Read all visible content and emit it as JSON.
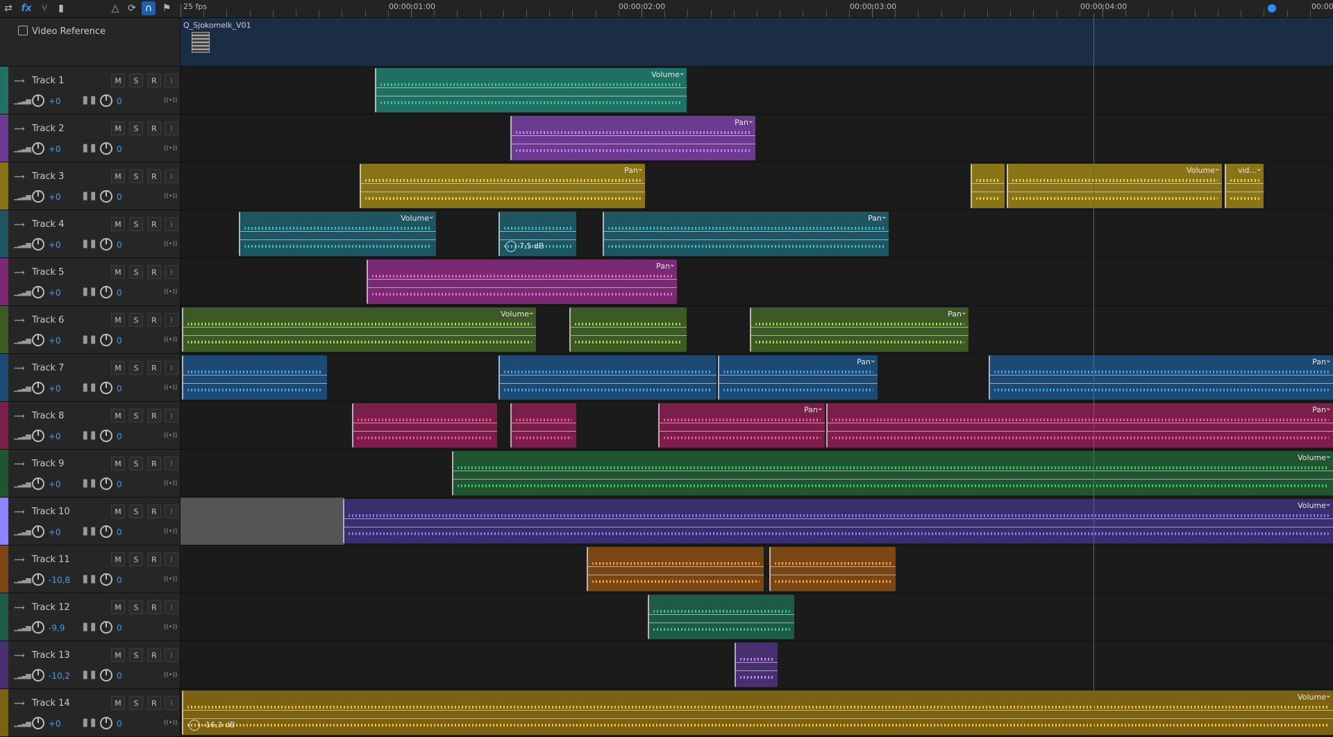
{
  "toolbar": {
    "icons": [
      "swap-arrows-icon",
      "fx-icon",
      "branch-icon",
      "bar-chart-icon",
      "metronome-icon",
      "loop-clip-icon",
      "headphones-icon",
      "marker-icon"
    ],
    "fx_label": "fx"
  },
  "ruler": {
    "fps": "25 fps",
    "timecodes": [
      "00:00:01:00",
      "00:00:02:00",
      "00:00:03:00",
      "00:00:04:00",
      "00:00"
    ]
  },
  "video_reference": {
    "label": "Video Reference",
    "clip_name": "Q_Sjokomelk_V01"
  },
  "tracks": [
    {
      "name": "Track 1",
      "volume": "+0",
      "pan": "0",
      "color": "#1f6f62",
      "clips": [
        {
          "start": 540,
          "end": 989,
          "param": "Volume",
          "wave": "#2fd0a0"
        }
      ]
    },
    {
      "name": "Track 2",
      "volume": "+0",
      "pan": "0",
      "color": "#6b3b8f",
      "clips": [
        {
          "start": 735,
          "end": 1088,
          "param": "Pan",
          "wave": "#d27bff"
        }
      ]
    },
    {
      "name": "Track 3",
      "volume": "+0",
      "pan": "0",
      "color": "#8a7418",
      "clips": [
        {
          "start": 518,
          "end": 929,
          "param": "Pan",
          "wave": "#f2d23a"
        },
        {
          "start": 1398,
          "end": 1447,
          "param": "",
          "wave": "#f2d23a"
        },
        {
          "start": 1450,
          "end": 1760,
          "param": "Volume",
          "wave": "#f2d23a"
        },
        {
          "start": 1764,
          "end": 1820,
          "param": "vid...",
          "wave": "#f2d23a"
        }
      ]
    },
    {
      "name": "Track 4",
      "volume": "+0",
      "pan": "0",
      "color": "#1e5560",
      "clips": [
        {
          "start": 344,
          "end": 628,
          "param": "Volume",
          "wave": "#2fc6d2"
        },
        {
          "start": 718,
          "end": 830,
          "param": "",
          "wave": "#2fc6d2",
          "badge": "7,5 dB"
        },
        {
          "start": 868,
          "end": 1280,
          "param": "Pan",
          "wave": "#2fc6d2"
        }
      ]
    },
    {
      "name": "Track 5",
      "volume": "+0",
      "pan": "0",
      "color": "#7a2a72",
      "clips": [
        {
          "start": 528,
          "end": 975,
          "param": "Pan",
          "wave": "#ff5cd9"
        }
      ]
    },
    {
      "name": "Track 6",
      "volume": "+0",
      "pan": "0",
      "color": "#3d5a26",
      "clips": [
        {
          "start": 262,
          "end": 772,
          "param": "Volume",
          "wave": "#9de04a"
        },
        {
          "start": 820,
          "end": 989,
          "param": "",
          "wave": "#9de04a"
        },
        {
          "start": 1080,
          "end": 1395,
          "param": "Pan",
          "wave": "#9de04a"
        }
      ]
    },
    {
      "name": "Track 7",
      "volume": "+0",
      "pan": "0",
      "color": "#1d4a75",
      "clips": [
        {
          "start": 262,
          "end": 471,
          "param": "",
          "wave": "#3aa8ff"
        },
        {
          "start": 718,
          "end": 1032,
          "param": "",
          "wave": "#3aa8ff"
        },
        {
          "start": 1034,
          "end": 1264,
          "param": "Pan",
          "wave": "#3aa8ff"
        },
        {
          "start": 1424,
          "end": 1920,
          "param": "Pan",
          "wave": "#3aa8ff"
        }
      ]
    },
    {
      "name": "Track 8",
      "volume": "+0",
      "pan": "0",
      "color": "#7a1f4a",
      "clips": [
        {
          "start": 507,
          "end": 716,
          "param": "",
          "wave": "#ff4fa8"
        },
        {
          "start": 735,
          "end": 830,
          "param": "",
          "wave": "#ff4fa8"
        },
        {
          "start": 948,
          "end": 1188,
          "param": "Pan",
          "wave": "#ff4fa8"
        },
        {
          "start": 1190,
          "end": 1920,
          "param": "Pan",
          "wave": "#ff4fa8"
        }
      ]
    },
    {
      "name": "Track 9",
      "volume": "+0",
      "pan": "0",
      "color": "#1f5530",
      "clips": [
        {
          "start": 651,
          "end": 1920,
          "param": "Volume",
          "wave": "#2fd06a"
        }
      ]
    },
    {
      "name": "Track 10",
      "volume": "+0",
      "pan": "0",
      "color": "#3a2f6e",
      "clips": [
        {
          "start": 494,
          "end": 1920,
          "param": "Volume",
          "wave": "#8c7dff"
        }
      ]
    },
    {
      "name": "Track 11",
      "volume": "-10,8",
      "pan": "0",
      "color": "#7a4613",
      "clips": [
        {
          "start": 845,
          "end": 1100,
          "param": "",
          "wave": "#ff9e2a"
        },
        {
          "start": 1108,
          "end": 1290,
          "param": "",
          "wave": "#ff9e2a"
        }
      ]
    },
    {
      "name": "Track 12",
      "volume": "-9,9",
      "pan": "0",
      "color": "#1f5a44",
      "clips": [
        {
          "start": 933,
          "end": 1144,
          "param": "",
          "wave": "#2fd096"
        }
      ]
    },
    {
      "name": "Track 13",
      "volume": "-10,2",
      "pan": "0",
      "color": "#4a2f70",
      "clips": [
        {
          "start": 1058,
          "end": 1120,
          "param": "",
          "wave": "#c38cff"
        }
      ]
    },
    {
      "name": "Track 14",
      "volume": "+0",
      "pan": "0",
      "color": "#7a6212",
      "clips": [
        {
          "start": 262,
          "end": 1920,
          "param": "Volume",
          "wave": "#f2c23a",
          "badge": "-16,3 dB"
        }
      ]
    }
  ],
  "track_buttons": {
    "m": "M",
    "s": "S",
    "r": "R",
    "i": "I"
  },
  "icons": {
    "volume_meter": "volume-meter-icon",
    "pan_meter": "pan-meter-icon",
    "output": "output-icon"
  },
  "playhead_timecode": "00:00:04:00"
}
